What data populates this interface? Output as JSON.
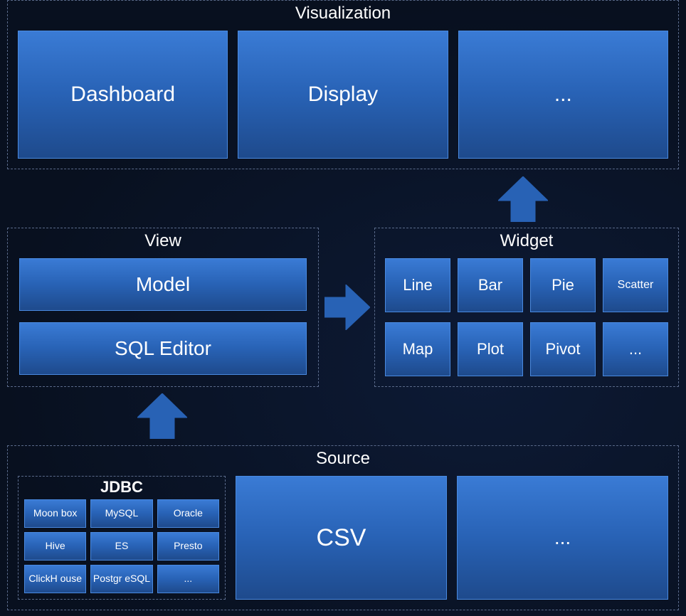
{
  "visualization": {
    "title": "Visualization",
    "items": [
      "Dashboard",
      "Display",
      "..."
    ]
  },
  "view": {
    "title": "View",
    "items": [
      "Model",
      "SQL Editor"
    ]
  },
  "widget": {
    "title": "Widget",
    "row1": [
      "Line",
      "Bar",
      "Pie",
      "Scatter"
    ],
    "row2": [
      "Map",
      "Plot",
      "Pivot",
      "..."
    ]
  },
  "source": {
    "title": "Source",
    "jdbc": {
      "title": "JDBC",
      "rows": [
        [
          "Moon box",
          "MySQL",
          "Oracle"
        ],
        [
          "Hive",
          "ES",
          "Presto"
        ],
        [
          "ClickH ouse",
          "Postgr eSQL",
          "..."
        ]
      ]
    },
    "csv": "CSV",
    "more": "..."
  }
}
